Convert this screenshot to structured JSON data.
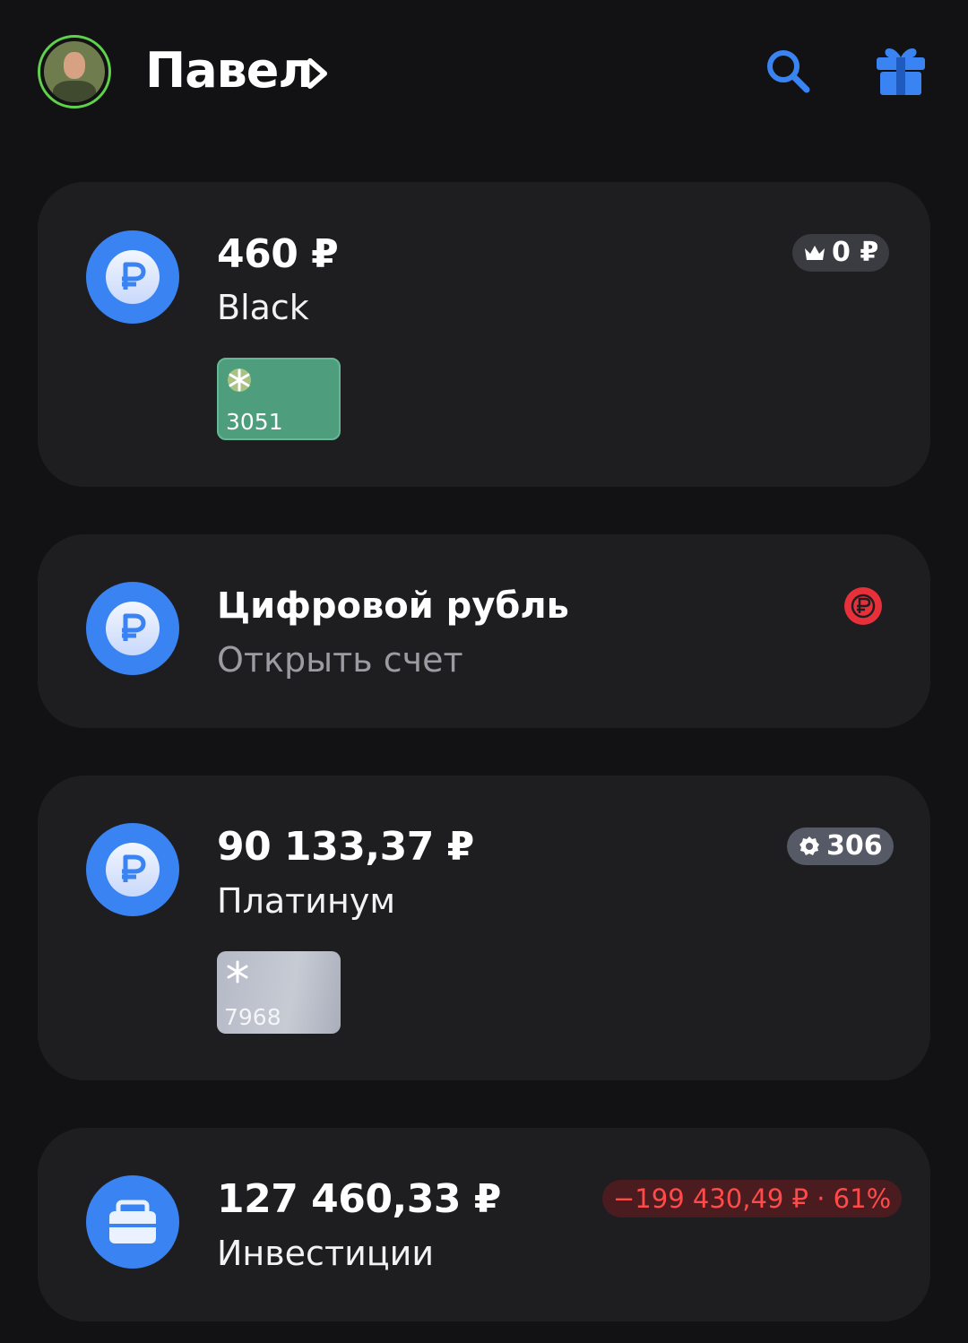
{
  "header": {
    "user_name": "Павел",
    "chevron": "›",
    "icons": [
      "avatar",
      "search-icon",
      "gift-icon"
    ]
  },
  "accounts": [
    {
      "amount": "460 ₽",
      "name": "Black",
      "badge": "0 ₽",
      "badge_icon": "crown-icon",
      "card_last4": "3051",
      "card_color": "#4e9e7d"
    },
    {
      "title": "Цифровой рубль",
      "subtitle": "Открыть счет",
      "badge_icon": "digital-ruble-icon"
    },
    {
      "amount": "90 133,37 ₽",
      "name": "Платинум",
      "badge": "306",
      "badge_icon": "bonus-gear-icon",
      "card_last4": "7968",
      "card_color": "#b4b9c6"
    },
    {
      "amount": "127 460,33 ₽",
      "name": "Инвестиции",
      "badge": "−199 430,49 ₽ · 61%",
      "icon": "briefcase-icon"
    }
  ],
  "colors": {
    "background": "#121214",
    "card": "#1e1e21",
    "accent_blue": "#3a83f2",
    "negative": "#ff4a4a"
  }
}
